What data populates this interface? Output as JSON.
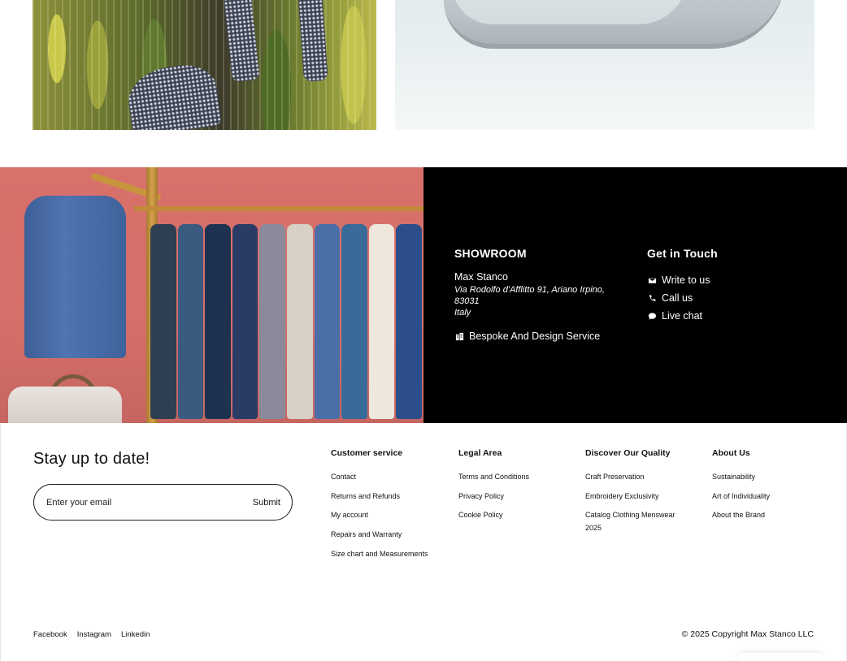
{
  "showroom": {
    "title": "SHOWROOM",
    "name": "Max Stanco",
    "address_line1": "Via Rodolfo d'Afflitto 91, Ariano Irpino,",
    "address_line2": "83031",
    "country": "Italy",
    "bespoke_label": "Bespoke And Design Service",
    "bespoke_icon": "building-icon"
  },
  "get_in_touch": {
    "title": "Get in Touch",
    "items": [
      {
        "label": "Write to us",
        "icon": "envelope-icon"
      },
      {
        "label": "Call us",
        "icon": "phone-icon"
      },
      {
        "label": "Live chat",
        "icon": "chat-bubble-icon"
      }
    ]
  },
  "newsletter": {
    "heading": "Stay up to date!",
    "placeholder": "Enter your email",
    "submit_label": "Submit"
  },
  "footer_columns": [
    {
      "title": "Customer service",
      "links": [
        "Contact",
        "Returns and Refunds",
        "My account",
        "Repairs and Warranty",
        "Size chart and Measurements"
      ]
    },
    {
      "title": "Legal Area",
      "links": [
        "Terms and Conditions",
        "Privacy Policy",
        "Cookie Policy"
      ]
    },
    {
      "title": "Discover Our Quality",
      "links": [
        "Craft Preservation",
        "Embroidery Exclusivity",
        "Catalog Clothing Menswear 2025"
      ]
    },
    {
      "title": "About Us",
      "links": [
        "Sustainability",
        "Art of Individuality",
        "About the Brand"
      ]
    }
  ],
  "social": [
    "Facebook",
    "Instagram",
    "Linkedin"
  ],
  "copyright": "© 2025 Copyright Max Stanco LLC",
  "colors": {
    "band_background": "#000000",
    "page_background": "#ffffff",
    "text": "#111111"
  }
}
